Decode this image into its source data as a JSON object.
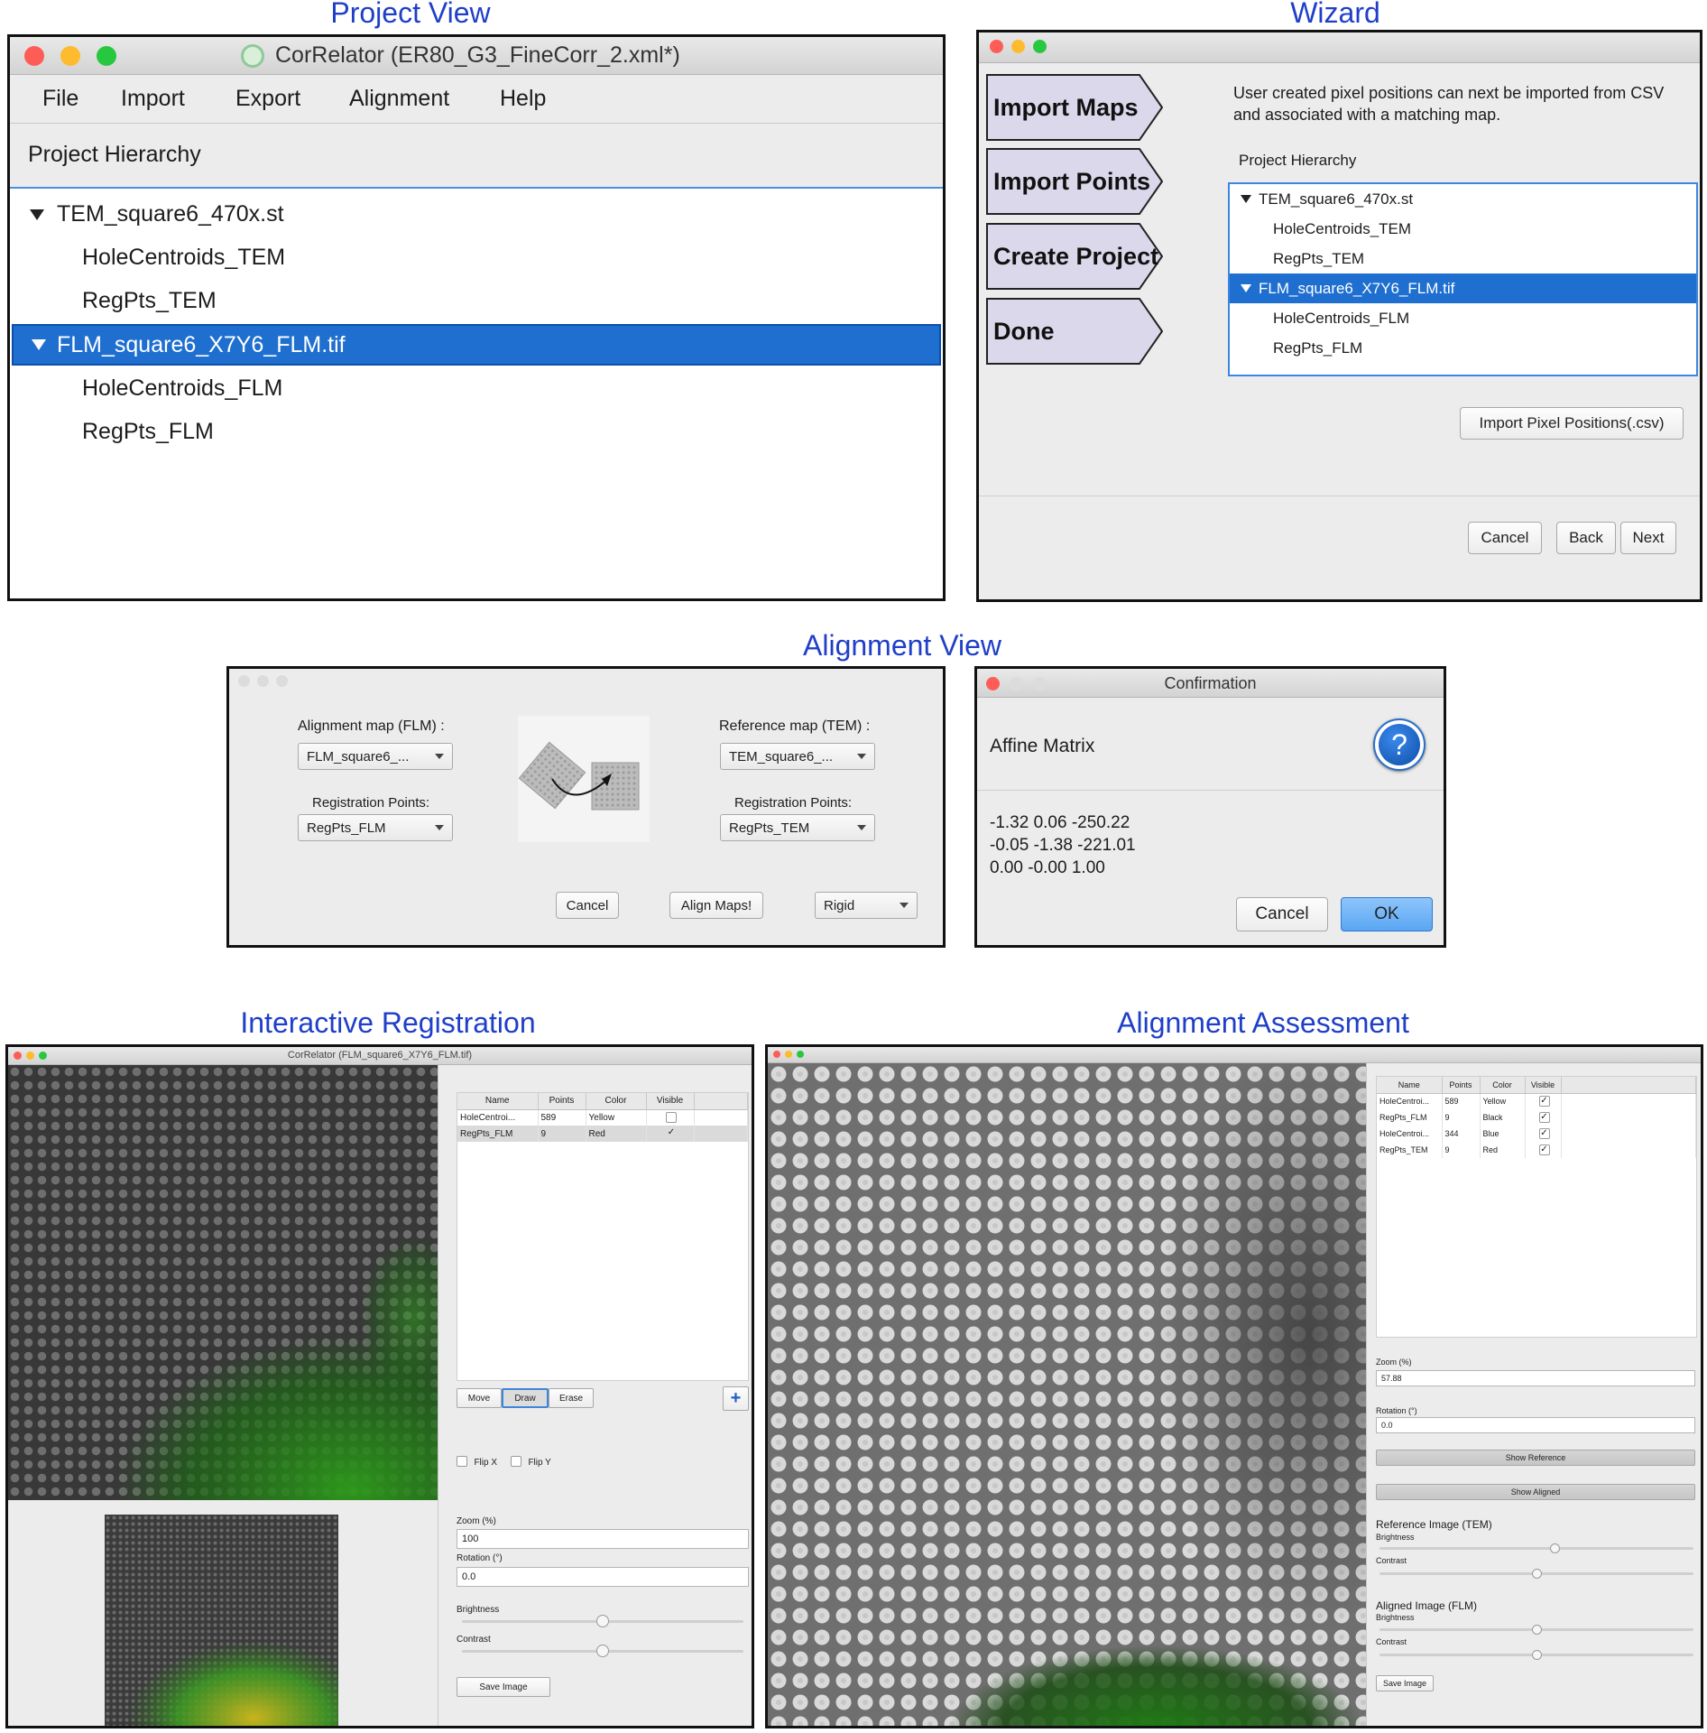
{
  "captions": {
    "project_view": "Project View",
    "wizard": "Wizard",
    "alignment_view": "Alignment View",
    "interactive_registration": "Interactive Registration",
    "alignment_assessment": "Alignment Assessment"
  },
  "project_view": {
    "title": "CorRelator (ER80_G3_FineCorr_2.xml*)",
    "menu": [
      "File",
      "Import",
      "Export",
      "Alignment",
      "Help"
    ],
    "hierarchy_label": "Project Hierarchy",
    "tree": [
      {
        "label": "TEM_square6_470x.st",
        "level": 0,
        "expanded": true,
        "selected": false
      },
      {
        "label": "HoleCentroids_TEM",
        "level": 1,
        "selected": false
      },
      {
        "label": "RegPts_TEM",
        "level": 1,
        "selected": false
      },
      {
        "label": "FLM_square6_X7Y6_FLM.tif",
        "level": 0,
        "expanded": true,
        "selected": true
      },
      {
        "label": "HoleCentroids_FLM",
        "level": 1,
        "selected": false
      },
      {
        "label": "RegPts_FLM",
        "level": 1,
        "selected": false
      }
    ]
  },
  "wizard": {
    "steps": [
      "Import Maps",
      "Import Points",
      "Create Project",
      "Done"
    ],
    "description": "User created pixel positions can next be imported from CSV and associated with a matching map.",
    "hierarchy_label": "Project Hierarchy",
    "import_button": "Import Pixel Positions(.csv)",
    "cancel": "Cancel",
    "back": "Back",
    "next": "Next"
  },
  "alignment_view": {
    "alignment_map_label": "Alignment map (FLM) :",
    "alignment_map_value": "FLM_square6_...",
    "reference_map_label": "Reference map (TEM) :",
    "reference_map_value": "TEM_square6_...",
    "reg_points_label": "Registration Points:",
    "reg_points_left": "RegPts_FLM",
    "reg_points_right": "RegPts_TEM",
    "cancel": "Cancel",
    "align": "Align Maps!",
    "mode": "Rigid"
  },
  "confirmation": {
    "title": "Confirmation",
    "heading": "Affine Matrix",
    "rows": [
      "-1.32 0.06 -250.22",
      "-0.05 -1.38 -221.01",
      "0.00 -0.00 1.00"
    ],
    "cancel": "Cancel",
    "ok": "OK",
    "icon": "question-icon"
  },
  "interactive_registration": {
    "title": "CorRelator (FLM_square6_X7Y6_FLM.tif)",
    "columns": [
      "Name",
      "Points",
      "Color",
      "Visible"
    ],
    "rows": [
      {
        "name": "HoleCentroi...",
        "points": "589",
        "color": "Yellow",
        "visible": ""
      },
      {
        "name": "RegPts_FLM",
        "points": "9",
        "color": "Red",
        "visible": "✓"
      }
    ],
    "tools": [
      "Move",
      "Draw",
      "Erase"
    ],
    "add": "+",
    "flip_x": "Flip X",
    "flip_y": "Flip Y",
    "zoom_label": "Zoom (%)",
    "zoom_value": "100",
    "rotation_label": "Rotation (°)",
    "rotation_value": "0.0",
    "brightness_label": "Brightness",
    "contrast_label": "Contrast",
    "save": "Save Image",
    "brightness_level": 0.5,
    "contrast_level": 0.5
  },
  "alignment_assessment": {
    "columns": [
      "Name",
      "Points",
      "Color",
      "Visible"
    ],
    "rows": [
      {
        "name": "HoleCentroi...",
        "points": "589",
        "color": "Yellow",
        "visible": "✓"
      },
      {
        "name": "RegPts_FLM",
        "points": "9",
        "color": "Black",
        "visible": "✓"
      },
      {
        "name": "HoleCentroi...",
        "points": "344",
        "color": "Blue",
        "visible": "✓"
      },
      {
        "name": "RegPts_TEM",
        "points": "9",
        "color": "Red",
        "visible": "✓"
      }
    ],
    "zoom_label": "Zoom (%)",
    "zoom_value": "57.88",
    "rotation_label": "Rotation (°)",
    "rotation_value": "0.0",
    "show_reference": "Show Reference",
    "show_aligned": "Show Aligned",
    "reference_image_label": "Reference Image (TEM)",
    "aligned_image_label": "Aligned Image (FLM)",
    "brightness_label": "Brightness",
    "contrast_label": "Contrast",
    "save": "Save Image",
    "ref_brightness_level": 0.56,
    "ref_contrast_level": 0.5,
    "al_brightness_level": 0.5,
    "al_contrast_level": 0.5
  },
  "colors": {
    "caption": "#1f3fc8",
    "selection": "#1f6fd0",
    "traffic_red": "#fd5d56",
    "traffic_yellow": "#fdbb2d",
    "traffic_green": "#27c840"
  }
}
